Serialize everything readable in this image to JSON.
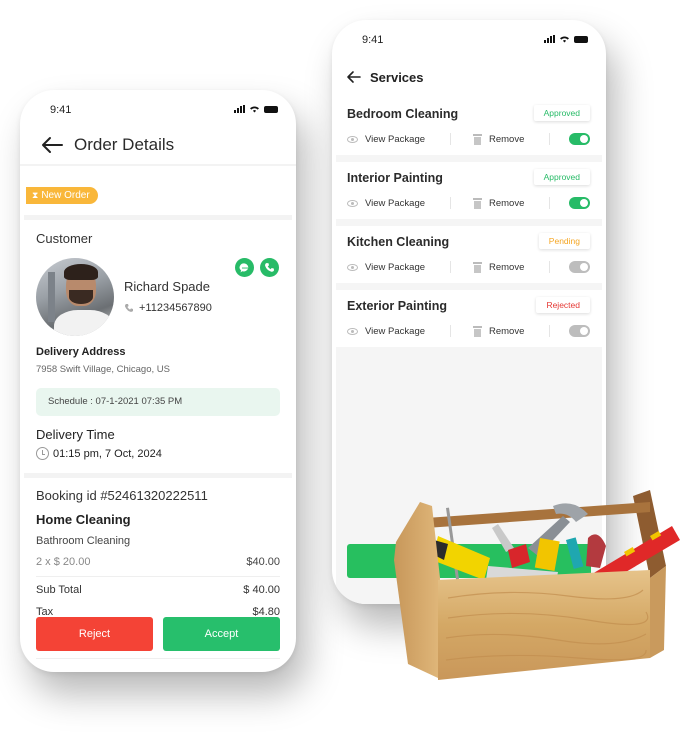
{
  "order_screen": {
    "status_time": "9:41",
    "title": "Order Details",
    "badge": "New Order",
    "customer_label": "Customer",
    "customer": {
      "name": "Richard Spade",
      "phone": "+11234567890"
    },
    "delivery_address_label": "Delivery Address",
    "delivery_address": "7958 Swift Village, Chicago, US",
    "schedule": "Schedule : 07-1-2021 07:35 PM",
    "delivery_time_label": "Delivery Time",
    "delivery_time": "01:15 pm, 7 Oct, 2024",
    "booking_id": "Booking id #52461320222511",
    "service_category": "Home Cleaning",
    "service_name": "Bathroom Cleaning",
    "quantity_price": "2 x $ 20.00",
    "line_total": "$40.00",
    "subtotal_label": "Sub Total",
    "subtotal": "$ 40.00",
    "tax_label": "Tax",
    "tax": "$4.80",
    "reject_label": "Reject",
    "accept_label": "Accept"
  },
  "services_screen": {
    "status_time": "9:41",
    "title": "Services",
    "view_label": "View Package",
    "remove_label": "Remove",
    "items": [
      {
        "name": "Bedroom Cleaning",
        "status": "Approved",
        "status_color": "#27bb67",
        "enabled": true
      },
      {
        "name": "Interior Painting",
        "status": "Approved",
        "status_color": "#27bb67",
        "enabled": true
      },
      {
        "name": "Kitchen Cleaning",
        "status": "Pending",
        "status_color": "#f5a623",
        "enabled": false
      },
      {
        "name": "Exterior Painting",
        "status": "Rejected",
        "status_color": "#e53935",
        "enabled": false
      }
    ]
  },
  "colors": {
    "primary_green": "#27bb67",
    "reject_red": "#f44336",
    "badge_orange": "#f9b73a",
    "schedule_bg": "#e9f6ef"
  }
}
